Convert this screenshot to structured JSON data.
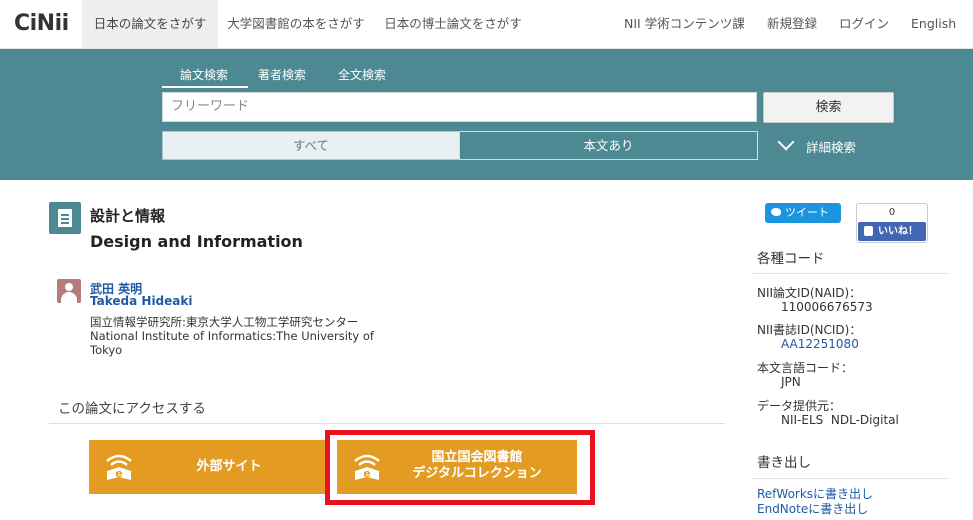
{
  "header": {
    "logo": "CiNii",
    "tabs": [
      "日本の論文をさがす",
      "大学図書館の本をさがす",
      "日本の博士論文をさがす"
    ],
    "links": [
      "NII 学術コンテンツ課",
      "新規登録",
      "ログイン",
      "English"
    ]
  },
  "search": {
    "tabs": [
      "論文検索",
      "著者検索",
      "全文検索"
    ],
    "placeholder": "フリーワード",
    "button": "検索",
    "filter_all": "すべて",
    "filter_fulltext": "本文あり",
    "advanced": "詳細検索"
  },
  "article": {
    "title_ja": "設計と情報",
    "title_en": "Design and Information",
    "author_ja": "武田 英明",
    "author_en": "Takeda Hideaki",
    "affiliation_ja": "国立情報学研究所:東京大学人工物工学研究センター",
    "affiliation_en": "National Institute of Informatics:The University of Tokyo"
  },
  "access": {
    "heading": "この論文にアクセスする",
    "external_button": "外部サイト",
    "ndl_button_line1": "国立国会図書館",
    "ndl_button_line2": "デジタルコレクション",
    "button_color": "#e39c21",
    "highlight_color": "#e8111d"
  },
  "social": {
    "tweet": "ツイート",
    "like_count": "0",
    "like_label": "いいね！"
  },
  "sidebar": {
    "codes_heading": "各種コード",
    "naid_label": "NII論文ID(NAID)：",
    "naid_value": "110006676573",
    "ncid_label": "NII書誌ID(NCID)：",
    "ncid_value": "AA12251080",
    "lang_label": "本文言語コード：",
    "lang_value": "JPN",
    "provider_label": "データ提供元：",
    "provider_value": "NII-ELS  NDL-Digital",
    "export_heading": "書き出し",
    "export_links": [
      "RefWorksに書き出し",
      "EndNoteに書き出し"
    ]
  },
  "colors": {
    "band": "#4d8992",
    "link": "#1f5aa8"
  }
}
